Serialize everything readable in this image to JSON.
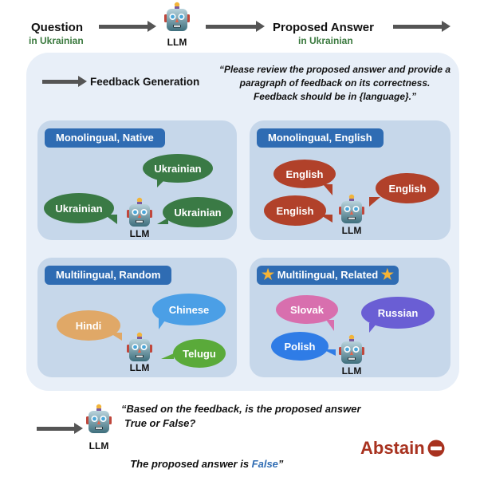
{
  "top_flow": {
    "question": {
      "title": "Question",
      "subtitle": "in Ukrainian"
    },
    "model": {
      "label": "LLM",
      "icon": "robot-icon"
    },
    "answer": {
      "title": "Proposed Answer",
      "subtitle": "in Ukrainian"
    }
  },
  "feedback": {
    "heading": "Feedback Generation",
    "prompt": "“Please review the proposed answer and provide a paragraph of feedback on its correctness. Feedback should be in {language}.”",
    "panels": [
      {
        "title": "Monolingual, Native",
        "starred": false,
        "llm_label": "LLM",
        "bubbles": [
          {
            "text": "Ukrainian",
            "color": "#3a7a45"
          },
          {
            "text": "Ukrainian",
            "color": "#3a7a45"
          },
          {
            "text": "Ukrainian",
            "color": "#3a7a45"
          }
        ]
      },
      {
        "title": "Monolingual, English",
        "starred": false,
        "llm_label": "LLM",
        "bubbles": [
          {
            "text": "English",
            "color": "#b1412a"
          },
          {
            "text": "English",
            "color": "#b1412a"
          },
          {
            "text": "English",
            "color": "#b1412a"
          }
        ]
      },
      {
        "title": "Multilingual, Random",
        "starred": false,
        "llm_label": "LLM",
        "bubbles": [
          {
            "text": "Hindi",
            "color": "#e0a867"
          },
          {
            "text": "Chinese",
            "color": "#4b9fe6"
          },
          {
            "text": "Telugu",
            "color": "#5aaa3a"
          }
        ]
      },
      {
        "title": "Multilingual, Related",
        "starred": true,
        "star_icon": "★",
        "llm_label": "LLM",
        "bubbles": [
          {
            "text": "Slovak",
            "color": "#d86fae"
          },
          {
            "text": "Russian",
            "color": "#6a5ed4"
          },
          {
            "text": "Polish",
            "color": "#2f7ce6"
          }
        ]
      }
    ]
  },
  "decision": {
    "llm_label": "LLM",
    "question_line1": "“Based on the feedback, is the proposed answer",
    "question_line2": "True or False?",
    "answer_prefix": "The proposed answer is ",
    "answer_value": "False",
    "answer_suffix": "”",
    "answer_color": "#2f6cb3",
    "outcome": "Abstain",
    "outcome_color": "#a8321f",
    "outcome_icon": "no-entry-icon"
  }
}
